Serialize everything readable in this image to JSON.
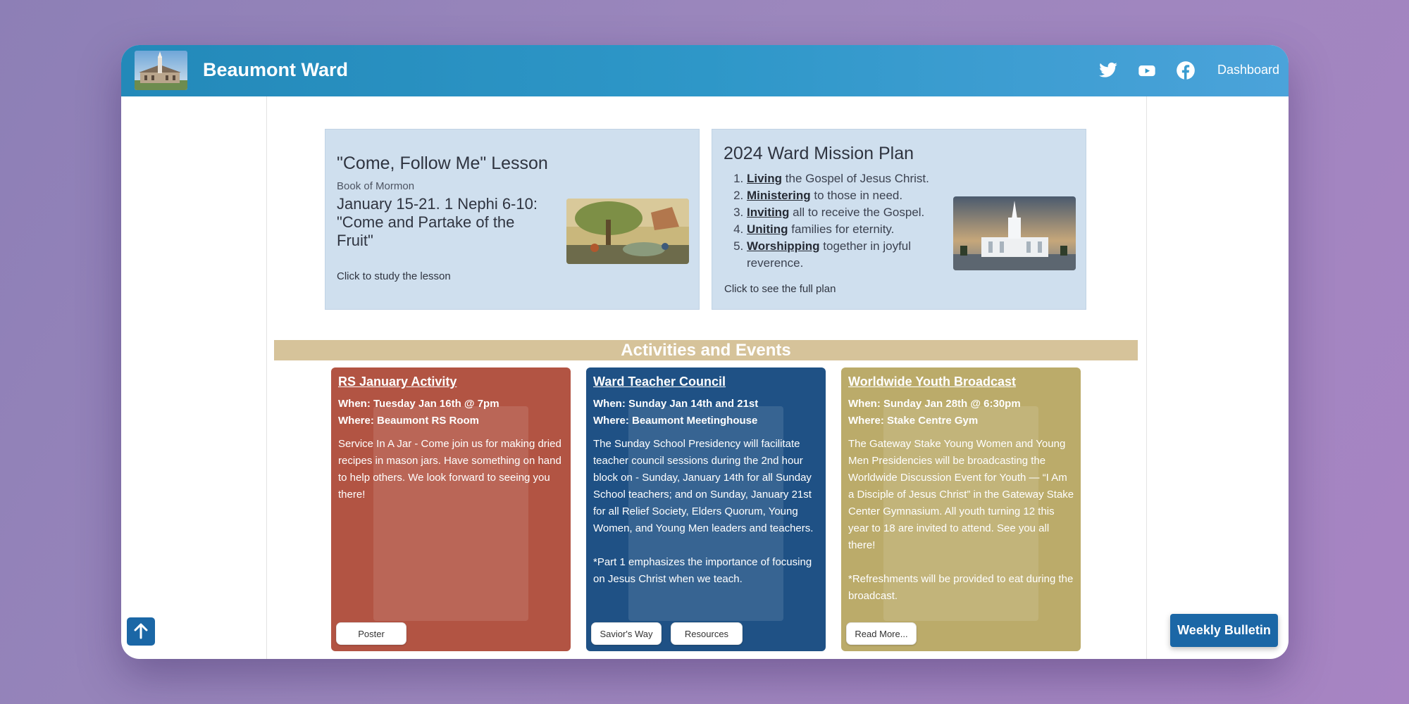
{
  "site": {
    "title": "Beaumont Ward"
  },
  "nav": {
    "social": [
      "twitter-icon",
      "youtube-icon",
      "facebook-icon"
    ],
    "dashboard_label": "Dashboard"
  },
  "lesson_card": {
    "title": "\"Come, Follow Me\" Lesson",
    "subtitle": "Book of Mormon",
    "reading": "January 15-21. 1 Nephi 6-10: \"Come and Partake of the Fruit\"",
    "link_text": "Click to study the lesson"
  },
  "mission_card": {
    "title": "2024 Ward Mission Plan",
    "items": [
      {
        "keyword": "Living",
        "rest": " the Gospel of Jesus Christ."
      },
      {
        "keyword": "Ministering",
        "rest": " to those in need."
      },
      {
        "keyword": "Inviting",
        "rest": " all to receive the Gospel."
      },
      {
        "keyword": "Uniting",
        "rest": " families for eternity."
      },
      {
        "keyword": "Worshipping",
        "rest": " together in joyful reverence."
      }
    ],
    "link_text": "Click to see the full plan"
  },
  "activities": {
    "heading": "Activities and Events",
    "cards": [
      {
        "title": "RS January Activity",
        "when": "When: Tuesday Jan 16th @ 7pm",
        "where": "Where: Beaumont RS Room",
        "description": "Service In A Jar - Come join us for making dried recipes in mason jars. Have something on hand to help others. We look forward to seeing you there!",
        "buttons": [
          "Poster"
        ],
        "color": "#b25443"
      },
      {
        "title": "Ward Teacher Council",
        "when": "When: Sunday Jan 14th and 21st",
        "where": "Where: Beaumont Meetinghouse",
        "description": "The Sunday School Presidency will facilitate teacher council sessions during the 2nd hour block on - Sunday, January 14th for all Sunday School teachers; and on Sunday, January 21st for all Relief Society, Elders Quorum, Young Women, and Young Men leaders and teachers.\n\n*Part 1 emphasizes the importance of focusing on Jesus Christ when we teach.",
        "buttons": [
          "Savior's Way",
          "Resources"
        ],
        "color": "#1f5185"
      },
      {
        "title": "Worldwide Youth Broadcast",
        "when": "When: Sunday Jan 28th @ 6:30pm",
        "where": "Where: Stake Centre Gym",
        "description": "The Gateway Stake Young Women and Young Men Presidencies will be broadcasting the Worldwide Discussion Event for Youth — “I Am a Disciple of Jesus Christ” in the Gateway Stake Center Gymnasium. All youth turning 12 this year to 18 are invited to attend. See you all there!\n\n*Refreshments will be provided to eat during the broadcast.",
        "buttons": [
          "Read More..."
        ],
        "color": "#bbab6a"
      }
    ]
  },
  "floating": {
    "scroll_top_icon": "arrow-up-icon",
    "bulletin_label": "Weekly Bulletin"
  }
}
